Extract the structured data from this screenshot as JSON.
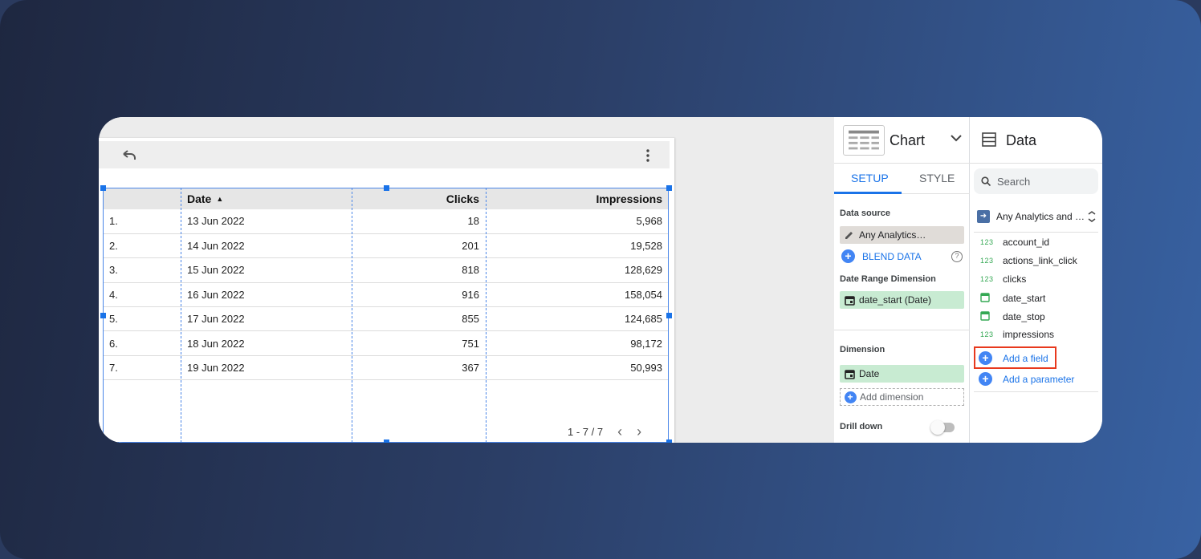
{
  "table": {
    "columns": [
      "",
      "Date",
      "Clicks",
      "Impressions"
    ],
    "sort_caret": "▲",
    "rows": [
      [
        "1.",
        "13 Jun 2022",
        "18",
        "5,968"
      ],
      [
        "2.",
        "14 Jun 2022",
        "201",
        "19,528"
      ],
      [
        "3.",
        "15 Jun 2022",
        "818",
        "128,629"
      ],
      [
        "4.",
        "16 Jun 2022",
        "916",
        "158,054"
      ],
      [
        "5.",
        "17 Jun 2022",
        "855",
        "124,685"
      ],
      [
        "6.",
        "18 Jun 2022",
        "751",
        "98,172"
      ],
      [
        "7.",
        "19 Jun 2022",
        "367",
        "50,993"
      ]
    ],
    "pagination": "1 - 7 / 7",
    "prev_glyph": "‹",
    "next_glyph": "›"
  },
  "props": {
    "title": "Chart",
    "tabs": [
      "SETUP",
      "STYLE"
    ],
    "active_tab": "SETUP",
    "data_source_label": "Data source",
    "data_source_value": "Any Analytics…",
    "blend_label": "BLEND DATA",
    "help_glyph": "?",
    "date_range_label": "Date Range Dimension",
    "date_range_value": "date_start (Date)",
    "dimension_label": "Dimension",
    "dimension_value": "Date",
    "add_dimension": "Add dimension",
    "drill_down_label": "Drill down",
    "drill_down_on": false
  },
  "data_panel": {
    "title": "Data",
    "search_placeholder": "Search",
    "source_name": "Any Analytics and …",
    "fields": [
      {
        "type": "number",
        "tag": "123",
        "name": "account_id"
      },
      {
        "type": "number",
        "tag": "123",
        "name": "actions_link_click"
      },
      {
        "type": "number",
        "tag": "123",
        "name": "clicks"
      },
      {
        "type": "date",
        "tag": "",
        "name": "date_start"
      },
      {
        "type": "date",
        "tag": "",
        "name": "date_stop"
      },
      {
        "type": "number",
        "tag": "123",
        "name": "impressions"
      }
    ],
    "add_field": "Add a field",
    "add_parameter": "Add a parameter"
  },
  "colors": {
    "accent": "#1a73e8",
    "highlight": "#e8391d",
    "dimension_chip": "#c8ebd2",
    "number_tag": "#34a853"
  }
}
